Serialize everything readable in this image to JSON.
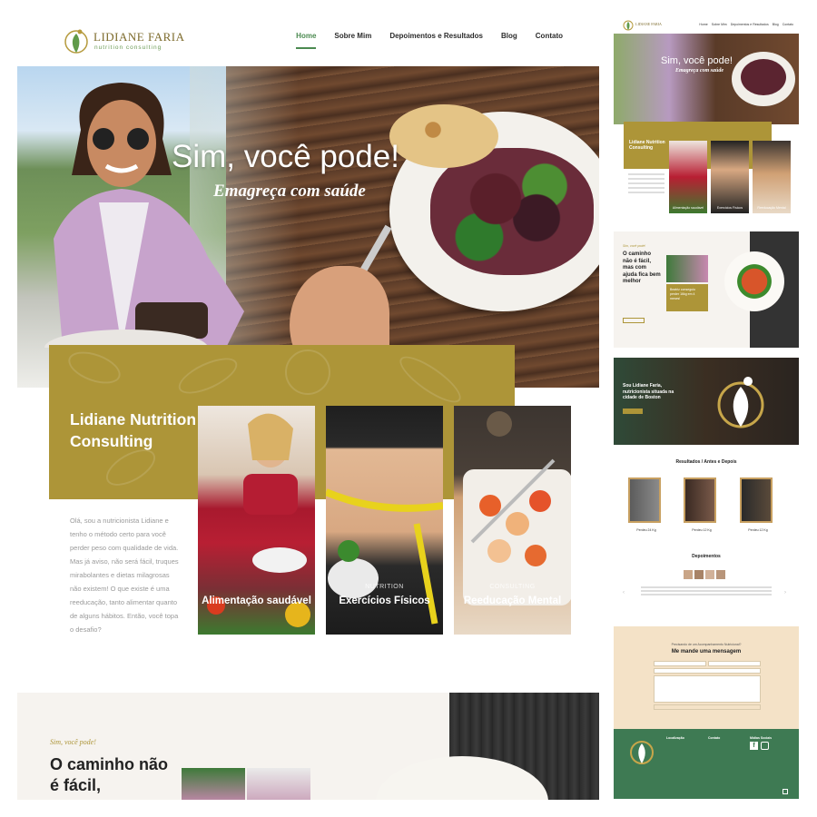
{
  "site": {
    "logo_name": "LIDIANE FARIA",
    "logo_tagline": "nutrition consulting"
  },
  "nav": {
    "items": [
      "Home",
      "Sobre Mim",
      "Depoimentos e Resultados",
      "Blog",
      "Contato"
    ],
    "active": "Home"
  },
  "hero": {
    "title": "Sim, você pode!",
    "subtitle": "Emagreça com saúde"
  },
  "about": {
    "heading": "Lidiane Nutrition Consulting",
    "body": "Olá, sou a nutricionista Lidiane e tenho o método certo para você perder peso com qualidade de vida. Mas já aviso, não será fácil, truques mirabolantes e dietas milagrosas não existem! O que existe é uma reeducação, tanto alimentar quanto de alguns hábitos. Então, você topa o desafio?"
  },
  "cards": [
    {
      "category": "",
      "title": "Alimentação saudável"
    },
    {
      "category": "NUTRITION",
      "title": "Exercícios Físicos"
    },
    {
      "category": "CONSULTING",
      "title": "Reeducação Mental"
    }
  ],
  "section2": {
    "kicker": "Sim, você pode!",
    "title": "O caminho não é fácil,"
  },
  "preview": {
    "nav_items": [
      "Home",
      "Sobre Mim",
      "Depoimentos e Resultados",
      "Blog",
      "Contato"
    ],
    "hero_title": "Sim, você pode!",
    "hero_subtitle": "Emagreça com saúde",
    "about_heading": "Lidiane Nutrition Consulting",
    "card_titles": [
      "Alimentação saudável",
      "Exercícios Físicos",
      "Reeducação Mental"
    ],
    "s2_kicker": "Sim, você pode!",
    "s2_title": "O caminho não é fácil, mas com ajuda fica bem melhor",
    "s2_badge": "Beatriz conseguiu perder 16kg em 4 meses!",
    "boston_text": "Sou Lidiane Faria, nutricionista situada na cidade de Boston",
    "results_title": "Resultados / Antes e Depois",
    "results": [
      "Perdeu 24 Kg",
      "Perdeu 12 Kg",
      "Perdeu 12 Kg"
    ],
    "testimonials_title": "Depoimentos",
    "contact_kicker": "Precisando de um Acompanhamento Nutricional?",
    "contact_title": "Me mande uma mensagem",
    "footer_cols": [
      "Localização",
      "Contato",
      "Mídias Sociais"
    ]
  },
  "colors": {
    "gold": "#ad9538",
    "green": "#4b8a50",
    "footer_green": "#3e7a53",
    "contact_bg": "#f4e2c7"
  }
}
